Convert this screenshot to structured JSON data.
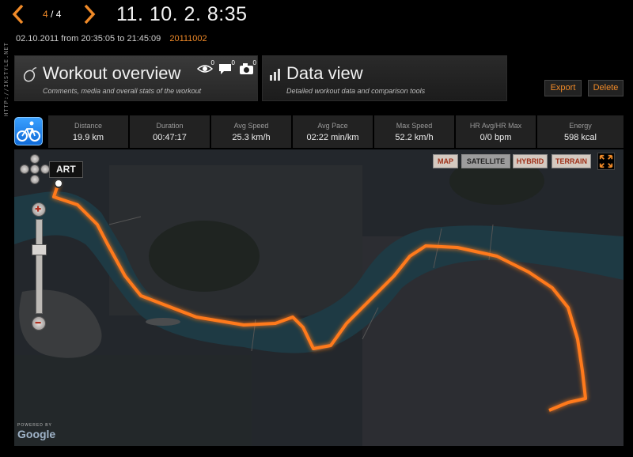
{
  "watermark": "HTTP://IKSTYLE.NET",
  "nav": {
    "current": "4",
    "total": "4"
  },
  "header": {
    "datetime": "11. 10. 2.   8:35"
  },
  "subinfo": {
    "range": "02.10.2011 from 20:35:05 to 21:45:09",
    "workout_id": "20111002"
  },
  "tabs": {
    "overview": {
      "title": "Workout overview",
      "subtitle": "Comments, media and overall stats of the workout",
      "views": "0",
      "comments": "0",
      "photos": "0"
    },
    "data": {
      "title": "Data view",
      "subtitle": "Detailed workout data and comparison tools"
    }
  },
  "actions": {
    "export": "Export",
    "delete": "Delete"
  },
  "stats": [
    {
      "label": "Distance",
      "value": "19.9 km"
    },
    {
      "label": "Duration",
      "value": "00:47:17"
    },
    {
      "label": "Avg Speed",
      "value": "25.3 km/h"
    },
    {
      "label": "Avg Pace",
      "value": "02:22 min/km"
    },
    {
      "label": "Max Speed",
      "value": "52.2 km/h"
    },
    {
      "label": "HR Avg/HR Max",
      "value": "0/0 bpm"
    },
    {
      "label": "Energy",
      "value": "598 kcal"
    }
  ],
  "map": {
    "types": {
      "map": "MAP",
      "satellite": "SATELLITE",
      "hybrid": "HYBRID",
      "terrain": "TERRAIN"
    },
    "start_label": "ART",
    "powered": "POWERED BY",
    "provider": "Google",
    "zoom_level_fraction": 0.27
  },
  "colors": {
    "accent": "#f08a28",
    "route": "#ff7a1a",
    "river": "#1e3a44"
  }
}
